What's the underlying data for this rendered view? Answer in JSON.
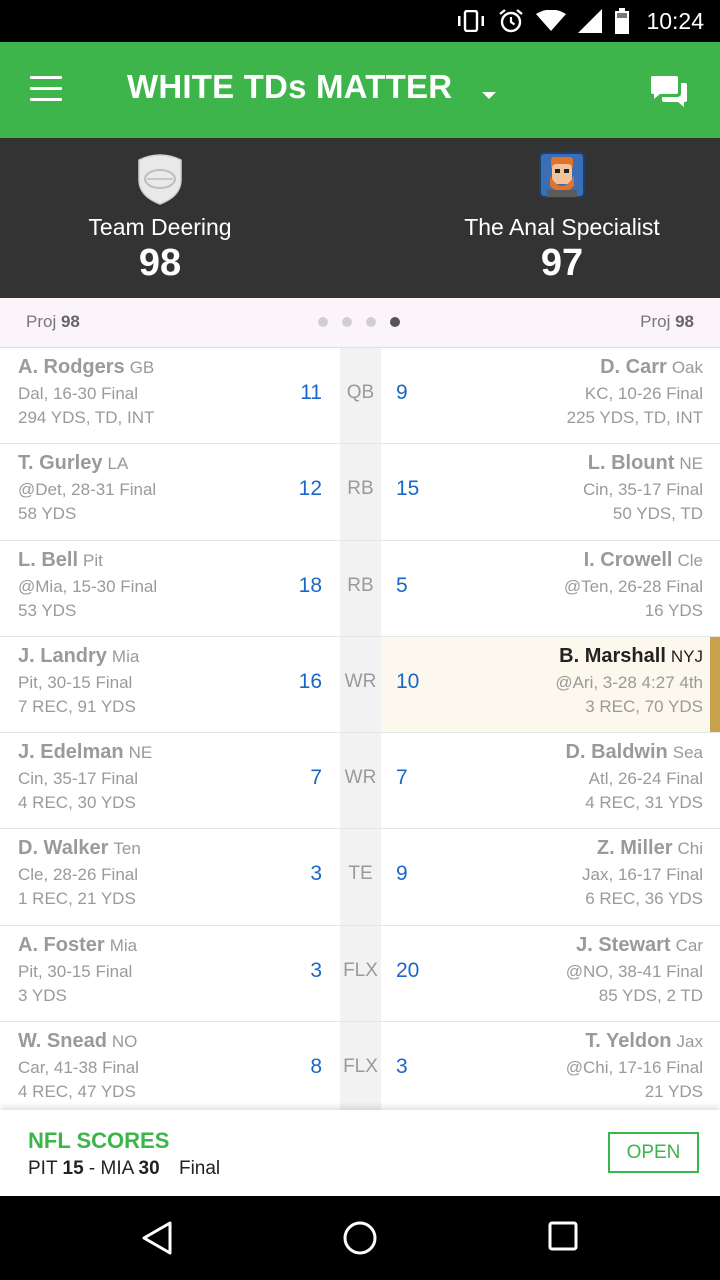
{
  "status_bar": {
    "time": "10:24",
    "icons": [
      "vibrate-icon",
      "alarm-icon",
      "wifi-icon",
      "signal-icon",
      "battery-icon"
    ]
  },
  "app_bar": {
    "title": "WHITE TDs MATTER",
    "icons": [
      "menu-icon",
      "dropdown-caret-icon",
      "chat-icon"
    ]
  },
  "matchup": {
    "home": {
      "name": "Team Deering",
      "score": "98",
      "logo": "football-shield-icon"
    },
    "away": {
      "name": "The Anal Specialist",
      "score": "97",
      "logo": "avatar-icon"
    },
    "proj_label": "Proj",
    "home_proj": "98",
    "away_proj": "98",
    "page_dots": 4,
    "active_dot": 4
  },
  "rows": [
    {
      "pos": "QB",
      "left": {
        "name": "A. Rodgers",
        "team": "GB",
        "game": "Dal, 16-30 Final",
        "stats": "294 YDS, TD, INT",
        "pts": "11"
      },
      "right": {
        "name": "D. Carr",
        "team": "Oak",
        "game": "KC, 10-26 Final",
        "stats": "225 YDS, TD, INT",
        "pts": "9"
      }
    },
    {
      "pos": "RB",
      "left": {
        "name": "T. Gurley",
        "team": "LA",
        "game": "@Det, 28-31 Final",
        "stats": "58 YDS",
        "pts": "12"
      },
      "right": {
        "name": "L. Blount",
        "team": "NE",
        "game": "Cin, 35-17 Final",
        "stats": "50 YDS, TD",
        "pts": "15"
      }
    },
    {
      "pos": "RB",
      "left": {
        "name": "L. Bell",
        "team": "Pit",
        "game": "@Mia, 15-30 Final",
        "stats": "53 YDS",
        "pts": "18"
      },
      "right": {
        "name": "I. Crowell",
        "team": "Cle",
        "game": "@Ten, 26-28 Final",
        "stats": "16 YDS",
        "pts": "5"
      }
    },
    {
      "pos": "WR",
      "live": true,
      "left": {
        "name": "J. Landry",
        "team": "Mia",
        "game": "Pit, 30-15 Final",
        "stats": "7 REC, 91 YDS",
        "pts": "16"
      },
      "right": {
        "name": "B. Marshall",
        "team": "NYJ",
        "game": "@Ari, 3-28 4:27 4th",
        "stats": "3 REC, 70 YDS",
        "pts": "10"
      }
    },
    {
      "pos": "WR",
      "left": {
        "name": "J. Edelman",
        "team": "NE",
        "game": "Cin, 35-17 Final",
        "stats": "4 REC, 30 YDS",
        "pts": "7"
      },
      "right": {
        "name": "D. Baldwin",
        "team": "Sea",
        "game": "Atl, 26-24 Final",
        "stats": "4 REC, 31 YDS",
        "pts": "7"
      }
    },
    {
      "pos": "TE",
      "left": {
        "name": "D. Walker",
        "team": "Ten",
        "game": "Cle, 28-26 Final",
        "stats": "1 REC, 21 YDS",
        "pts": "3"
      },
      "right": {
        "name": "Z. Miller",
        "team": "Chi",
        "game": "Jax, 16-17 Final",
        "stats": "6 REC, 36 YDS",
        "pts": "9"
      }
    },
    {
      "pos": "FLX",
      "left": {
        "name": "A. Foster",
        "team": "Mia",
        "game": "Pit, 30-15 Final",
        "stats": "3 YDS",
        "pts": "3"
      },
      "right": {
        "name": "J. Stewart",
        "team": "Car",
        "game": "@NO, 38-41 Final",
        "stats": "85 YDS, 2 TD",
        "pts": "20"
      }
    },
    {
      "pos": "FLX",
      "left": {
        "name": "W. Snead",
        "team": "NO",
        "game": "Car, 41-38 Final",
        "stats": "4 REC, 47 YDS",
        "pts": "8"
      },
      "right": {
        "name": "T. Yeldon",
        "team": "Jax",
        "game": "@Chi, 17-16 Final",
        "stats": "21 YDS",
        "pts": "3"
      }
    }
  ],
  "nfl_scores": {
    "title": "NFL SCORES",
    "away_team": "PIT",
    "away_score": "15",
    "separator": "-",
    "home_team": "MIA",
    "home_score": "30",
    "status": "Final",
    "open_label": "OPEN"
  },
  "nav_bar": {
    "icons": [
      "back-icon",
      "home-icon",
      "recents-icon"
    ]
  },
  "colors": {
    "brand_green": "#3db54a",
    "header_dark": "#333333",
    "points_blue": "#1a67c9",
    "live_gold": "#c8a24a"
  }
}
